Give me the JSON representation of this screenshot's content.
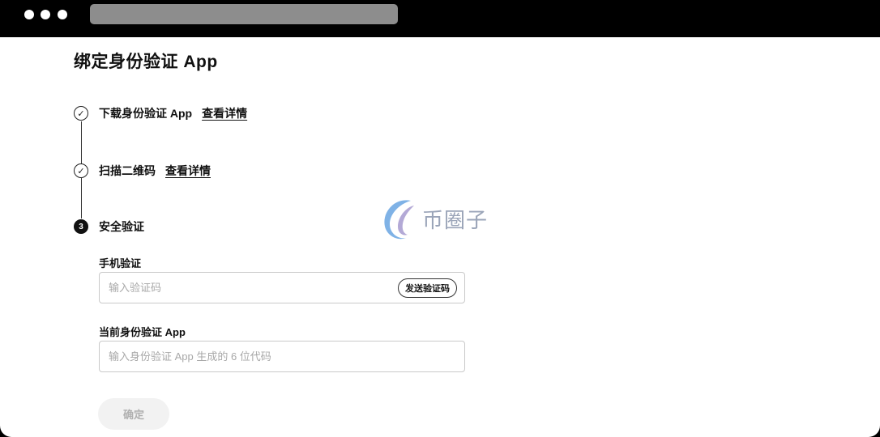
{
  "page": {
    "title": "绑定身份验证 App"
  },
  "steps": [
    {
      "status": "done",
      "icon": "check-icon",
      "label": "下载身份验证 App",
      "link": "查看详情"
    },
    {
      "status": "done",
      "icon": "check-icon",
      "label": "扫描二维码",
      "link": "查看详情"
    },
    {
      "status": "current",
      "number": "3",
      "label": "安全验证"
    }
  ],
  "form": {
    "phone": {
      "label": "手机验证",
      "placeholder": "输入验证码",
      "value": "",
      "send_button": "发送验证码"
    },
    "app_code": {
      "label": "当前身份验证 App",
      "placeholder": "输入身份验证 App 生成的 6 位代码",
      "value": ""
    },
    "confirm_button": "确定"
  },
  "watermark": {
    "text": "币圈子",
    "logo_icon": "bitquanzi-logo-icon"
  },
  "colors": {
    "titlebar": "#000000",
    "url_bar": "#8d8d8d",
    "confirm_disabled_bg": "#f2f2f2",
    "confirm_disabled_text": "#b0b0b0"
  }
}
